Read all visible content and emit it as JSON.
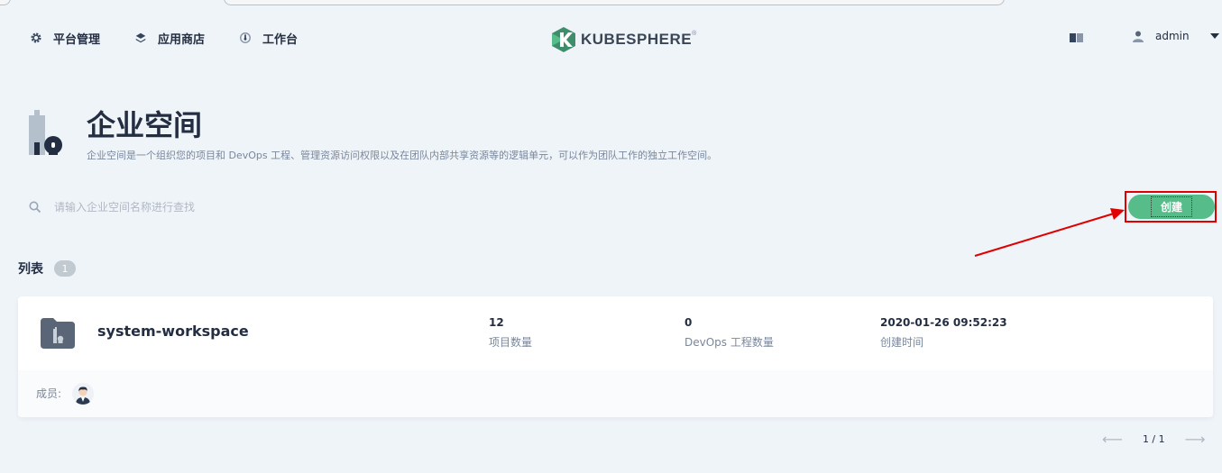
{
  "nav": {
    "items": [
      {
        "label": "平台管理",
        "icon": "gear-icon"
      },
      {
        "label": "应用商店",
        "icon": "layers-icon"
      },
      {
        "label": "工作台",
        "icon": "dashboard-icon"
      }
    ],
    "logo_text": "KUBESPHERE",
    "logo_mark": "®",
    "user": "admin"
  },
  "page": {
    "title": "企业空间",
    "description": "企业空间是一个组织您的项目和 DevOps 工程、管理资源访问权限以及在团队内部共享资源等的逻辑单元，可以作为团队工作的独立工作空间。"
  },
  "search": {
    "placeholder": "请输入企业空间名称进行查找"
  },
  "create_button": "创建",
  "list": {
    "title": "列表",
    "count": "1",
    "items": [
      {
        "name": "system-workspace",
        "projects_value": "12",
        "projects_label": "项目数量",
        "devops_value": "0",
        "devops_label": "DevOps 工程数量",
        "created_value": "2020-01-26 09:52:23",
        "created_label": "创建时间",
        "members_label": "成员:"
      }
    ]
  },
  "pagination": {
    "text": "1 / 1"
  },
  "colors": {
    "primary": "#55bc8a",
    "annotation": "#e00000",
    "text": "#242e42",
    "muted": "#79879c",
    "background": "#eff4f9"
  }
}
